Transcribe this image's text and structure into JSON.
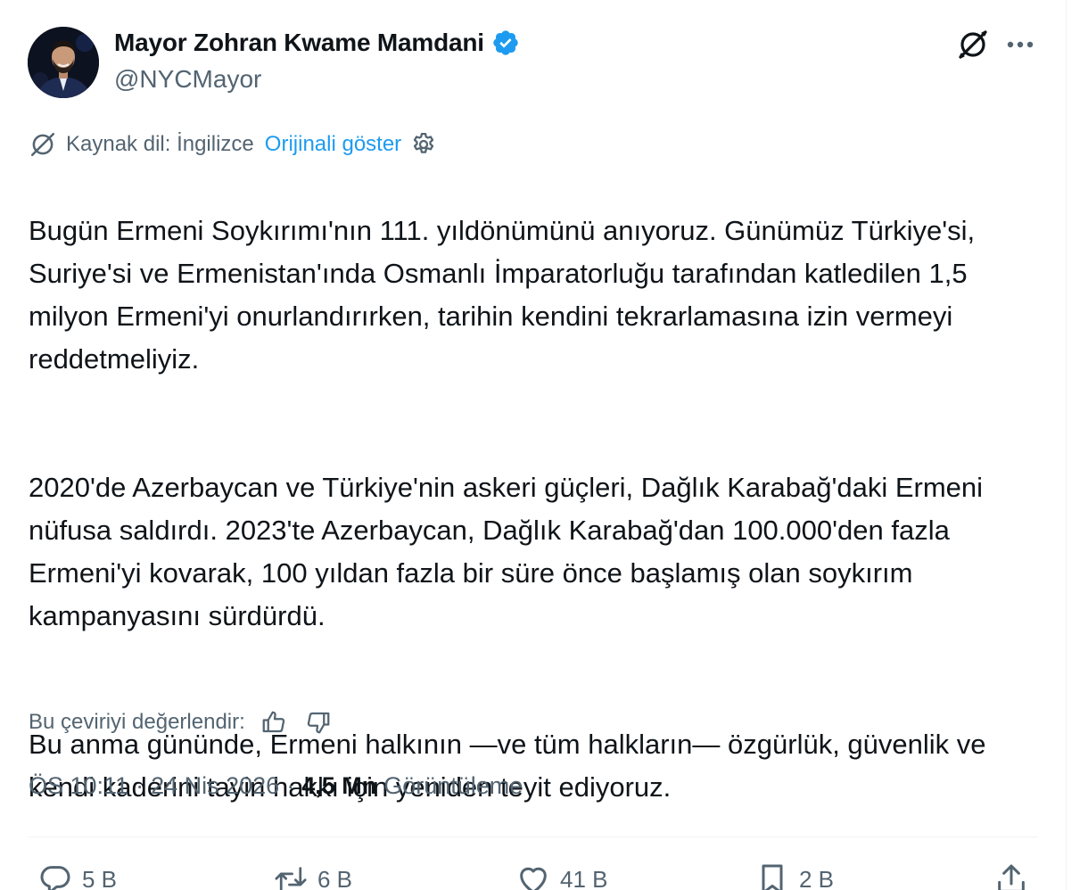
{
  "author": {
    "name": "Mayor Zohran Kwame Mamdani",
    "handle": "@NYCMayor"
  },
  "icons": {
    "verified": "verified-badge-icon",
    "translate": "translate-icon",
    "more": "more-options-icon",
    "settings": "gear-icon",
    "thumbs_up": "thumbs-up-icon",
    "thumbs_down": "thumbs-down-icon",
    "reply": "reply-icon",
    "repost": "repost-icon",
    "like": "heart-icon",
    "bookmark": "bookmark-icon",
    "share": "share-icon"
  },
  "translation": {
    "source_label": "Kaynak dil: İngilizce",
    "show_original": "Orijinali göster"
  },
  "text": {
    "p1": "Bugün Ermeni Soykırımı'nın 111. yıldönümünü anıyoruz. Günümüz Türkiye'si, Suriye'si ve Ermenistan'ında Osmanlı İmparatorluğu tarafından katledilen 1,5 milyon Ermeni'yi onurlandırırken, tarihin kendini tekrarlamasına izin vermeyi reddetmeliyiz.",
    "p2": "2020'de Azerbaycan ve Türkiye'nin askeri güçleri, Dağlık Karabağ'daki Ermeni nüfusa saldırdı. 2023'te Azerbaycan, Dağlık Karabağ'dan 100.000'den fazla Ermeni'yi kovarak, 100 yıldan fazla bir süre önce başlamış olan soykırım kampanyasını sürdürdü.",
    "p3": "Bu anma gününde, Ermeni halkının —ve tüm halkların— özgürlük, güvenlik ve kendi kaderini tayin hakkı için yeniden teyit ediyoruz."
  },
  "rate": {
    "label": "Bu çeviriyi değerlendir:"
  },
  "meta": {
    "time": "ÖS 10:11",
    "separator": "·",
    "date": "24 Nis 2026",
    "views_count": "4,5 Mn",
    "views_label": "Görüntüleme"
  },
  "actions": {
    "replies": "5 B",
    "reposts": "6 B",
    "likes": "41 B",
    "bookmarks": "2 B"
  },
  "colors": {
    "link": "#1d9bf0",
    "secondary": "#536471",
    "primary_text": "#0f1419",
    "verified": "#1d9bf0"
  }
}
